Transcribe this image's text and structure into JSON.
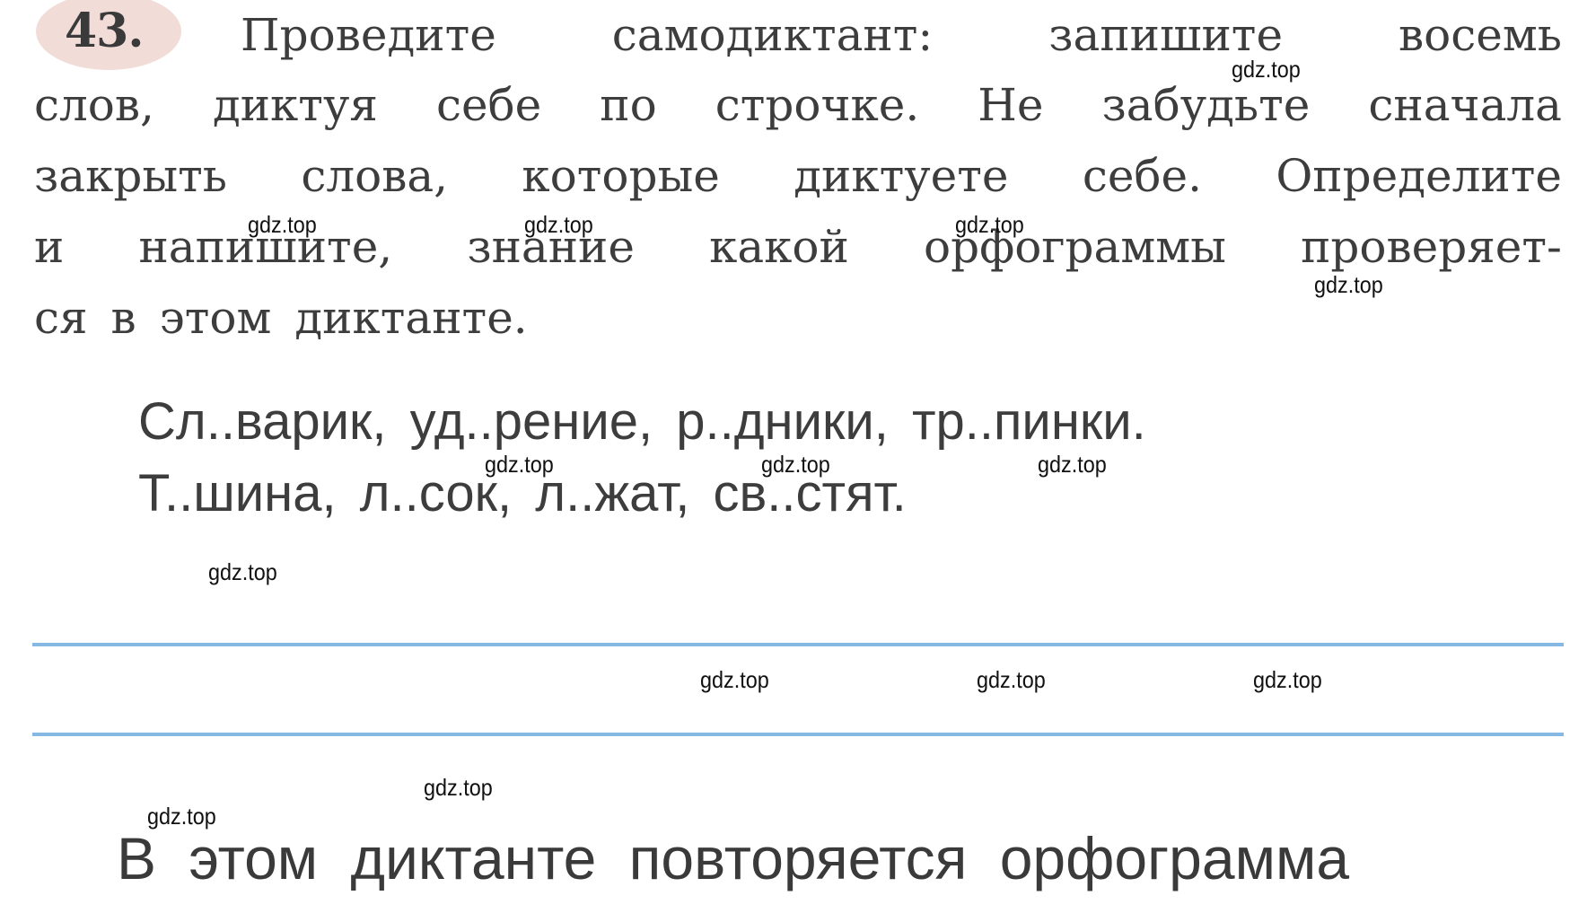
{
  "exercise": {
    "number": "43.",
    "instruction_lines": [
      [
        "Проведите",
        "самодиктант:",
        "запишите",
        "восемь"
      ],
      [
        "слов,",
        "диктуя",
        "себе",
        "по",
        "строчке.",
        "Не",
        "забудьте",
        "сначала"
      ],
      [
        "закрыть",
        "слова,",
        "которые",
        "диктуете",
        "себе.",
        "Определите"
      ],
      [
        "и",
        "напишите,",
        "знание",
        "какой",
        "орфограммы",
        "проверяет-"
      ],
      [
        "ся",
        "в",
        "этом",
        "диктанте."
      ]
    ],
    "dictation_words": [
      "Сл..варик,  уд..рение,  р..дники,  тр..пинки.",
      "Т..шина,  л..сок,  л..жат,  св..стят."
    ],
    "answer_prompt": "В этом диктанте повторяется орфограмма"
  },
  "colors": {
    "badge": "#f1dcd8",
    "rule": "#86b8e4",
    "text": "#3d3d3d"
  },
  "watermarks": [
    "gdz.top",
    "gdz.top",
    "gdz.top",
    "gdz.top",
    "gdz.top",
    "gdz.top",
    "gdz.top",
    "gdz.top",
    "gdz.top",
    "gdz.top",
    "gdz.top",
    "gdz.top",
    "gdz.top",
    "gdz.top",
    "gdz.top"
  ]
}
